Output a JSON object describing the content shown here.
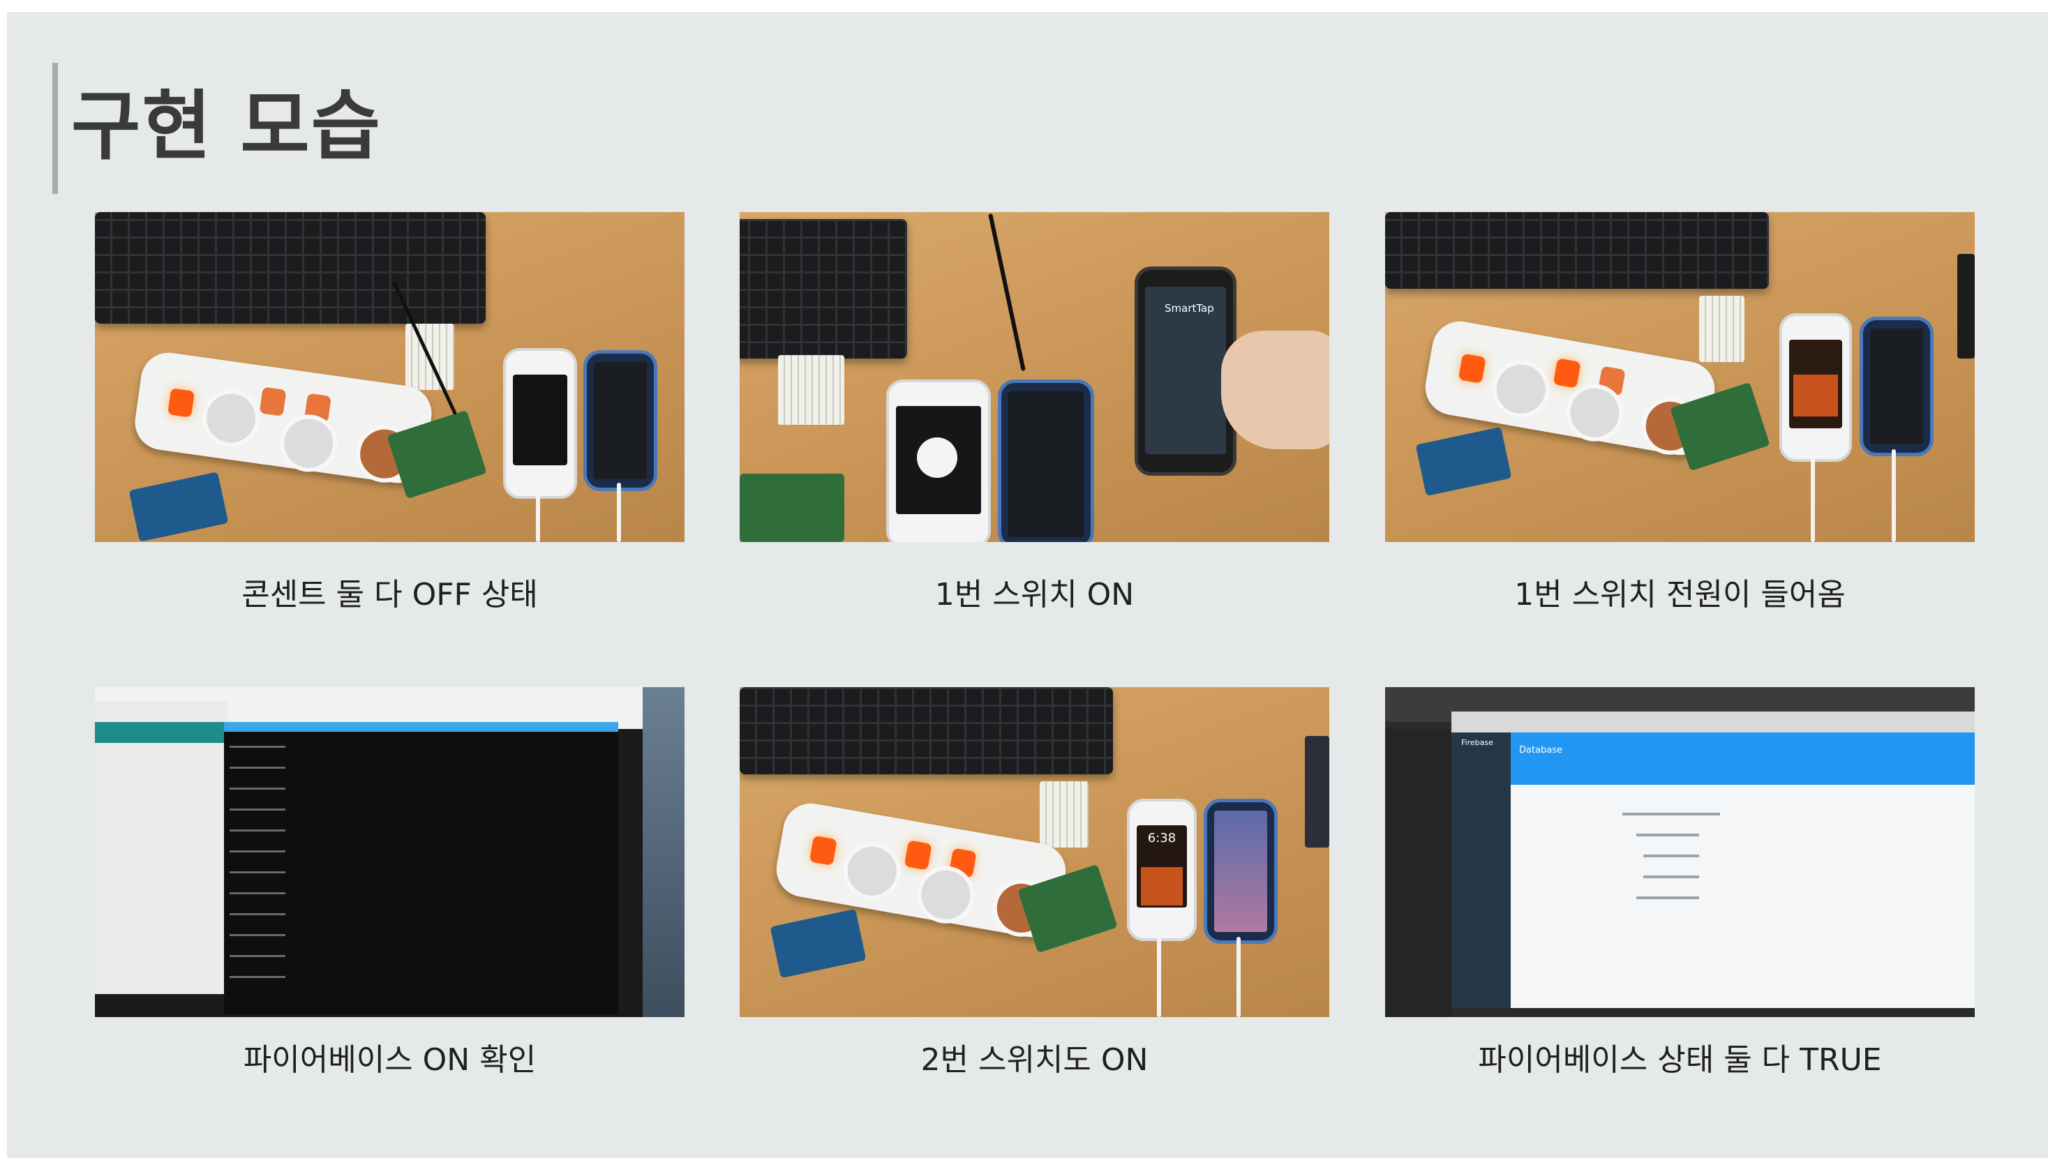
{
  "slide": {
    "title": "구현 모습"
  },
  "photos": [
    {
      "caption": "콘센트 둘 다 OFF 상태"
    },
    {
      "caption": "1번 스위치 ON"
    },
    {
      "caption": "1번 스위치 전원이 들어옴"
    },
    {
      "caption": "파이어베이스 ON 확인"
    },
    {
      "caption": "2번 스위치도 ON"
    },
    {
      "caption": "파이어베이스 상태 둘 다 TRUE"
    }
  ],
  "phone_screens": {
    "app_name": "SmartTap",
    "clock": "6:38"
  },
  "firebase": {
    "brand": "Firebase",
    "section": "Database"
  },
  "colors": {
    "background": "#e6e9e9",
    "accent_bar": "#a9abab",
    "title_text": "#3a3a3a"
  }
}
